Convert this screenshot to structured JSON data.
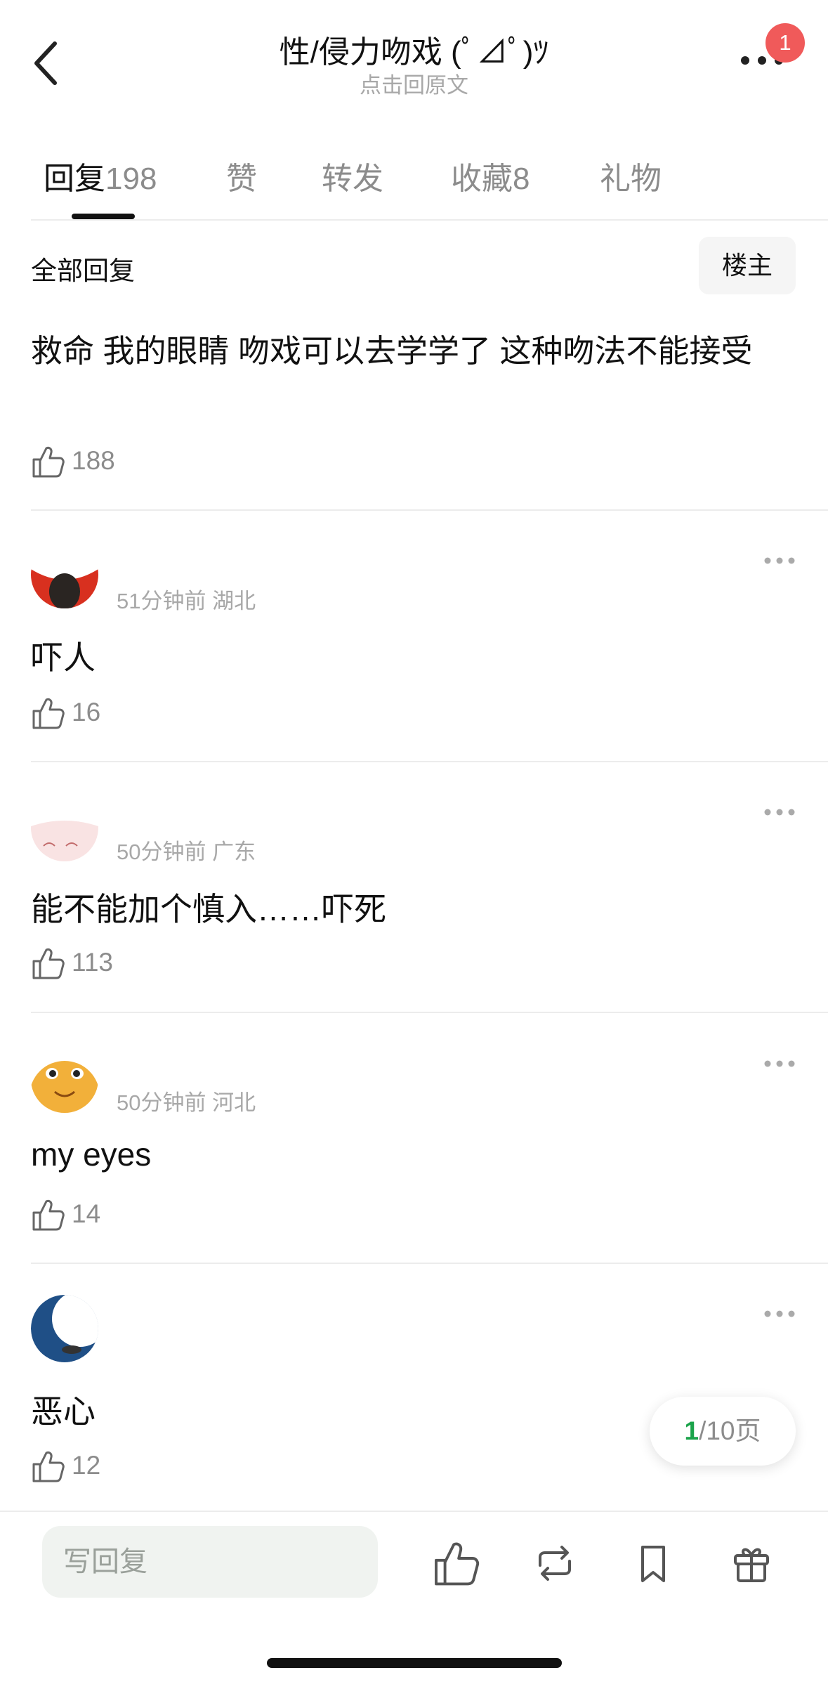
{
  "header": {
    "title": "性/侵力吻戏 (ﾟ⊿ﾟ)ﾂ",
    "subtitle": "点击回原文",
    "notification_count": "1",
    "back_icon": "chevron-left-icon",
    "more_icon": "ellipsis-icon"
  },
  "tabs": [
    {
      "label": "回复",
      "count": "198"
    },
    {
      "label": "赞",
      "count": ""
    },
    {
      "label": "转发",
      "count": ""
    },
    {
      "label": "收藏",
      "count": "8"
    },
    {
      "label": "礼物",
      "count": ""
    }
  ],
  "section": {
    "title": "全部回复",
    "filter_button": "楼主"
  },
  "main_comment": {
    "text": "救命 我的眼睛  吻戏可以去学学了 这种吻法不能接受",
    "likes": "188"
  },
  "comments": [
    {
      "meta": "51分钟前 湖北",
      "text": "吓人",
      "likes": "16"
    },
    {
      "meta": "50分钟前 广东",
      "text": "能不能加个慎入……吓死",
      "likes": "113"
    },
    {
      "meta": "50分钟前 河北",
      "text": "my eyes",
      "likes": "14"
    },
    {
      "meta": "",
      "text": "恶心",
      "likes": "12"
    }
  ],
  "pager": {
    "current": "1",
    "rest": "/10页"
  },
  "bottom_bar": {
    "reply_placeholder": "写回复"
  },
  "colors": {
    "accent_green": "#1aa34a",
    "badge_red": "#f05a5a",
    "muted": "#8c8c8c"
  }
}
